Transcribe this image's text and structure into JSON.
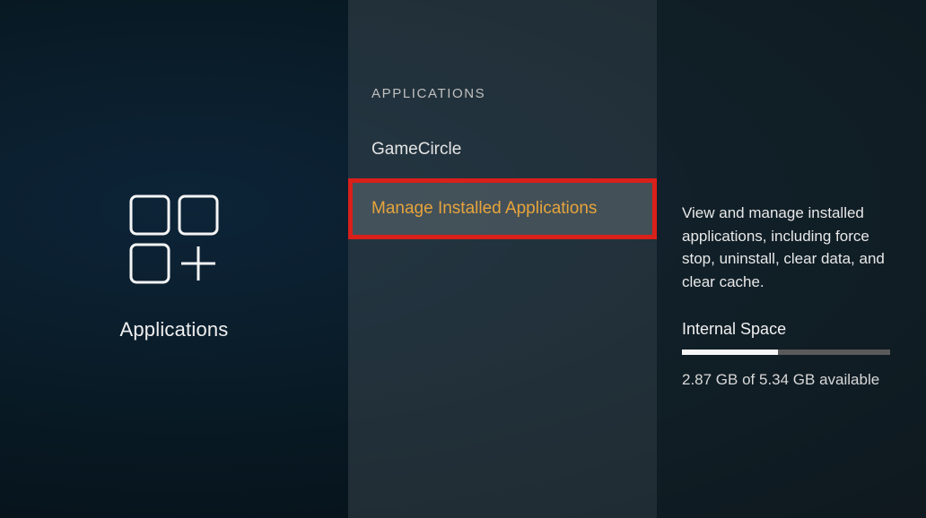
{
  "left": {
    "label": "Applications"
  },
  "middle": {
    "header": "APPLICATIONS",
    "items": [
      {
        "label": "GameCircle",
        "selected": false
      },
      {
        "label": "Manage Installed Applications",
        "selected": true
      }
    ]
  },
  "right": {
    "description": "View and manage installed applications, including force stop, uninstall, clear data, and clear cache.",
    "space_label": "Internal Space",
    "space_value": "2.87 GB of 5.34 GB available",
    "space_used_pct": 46
  }
}
